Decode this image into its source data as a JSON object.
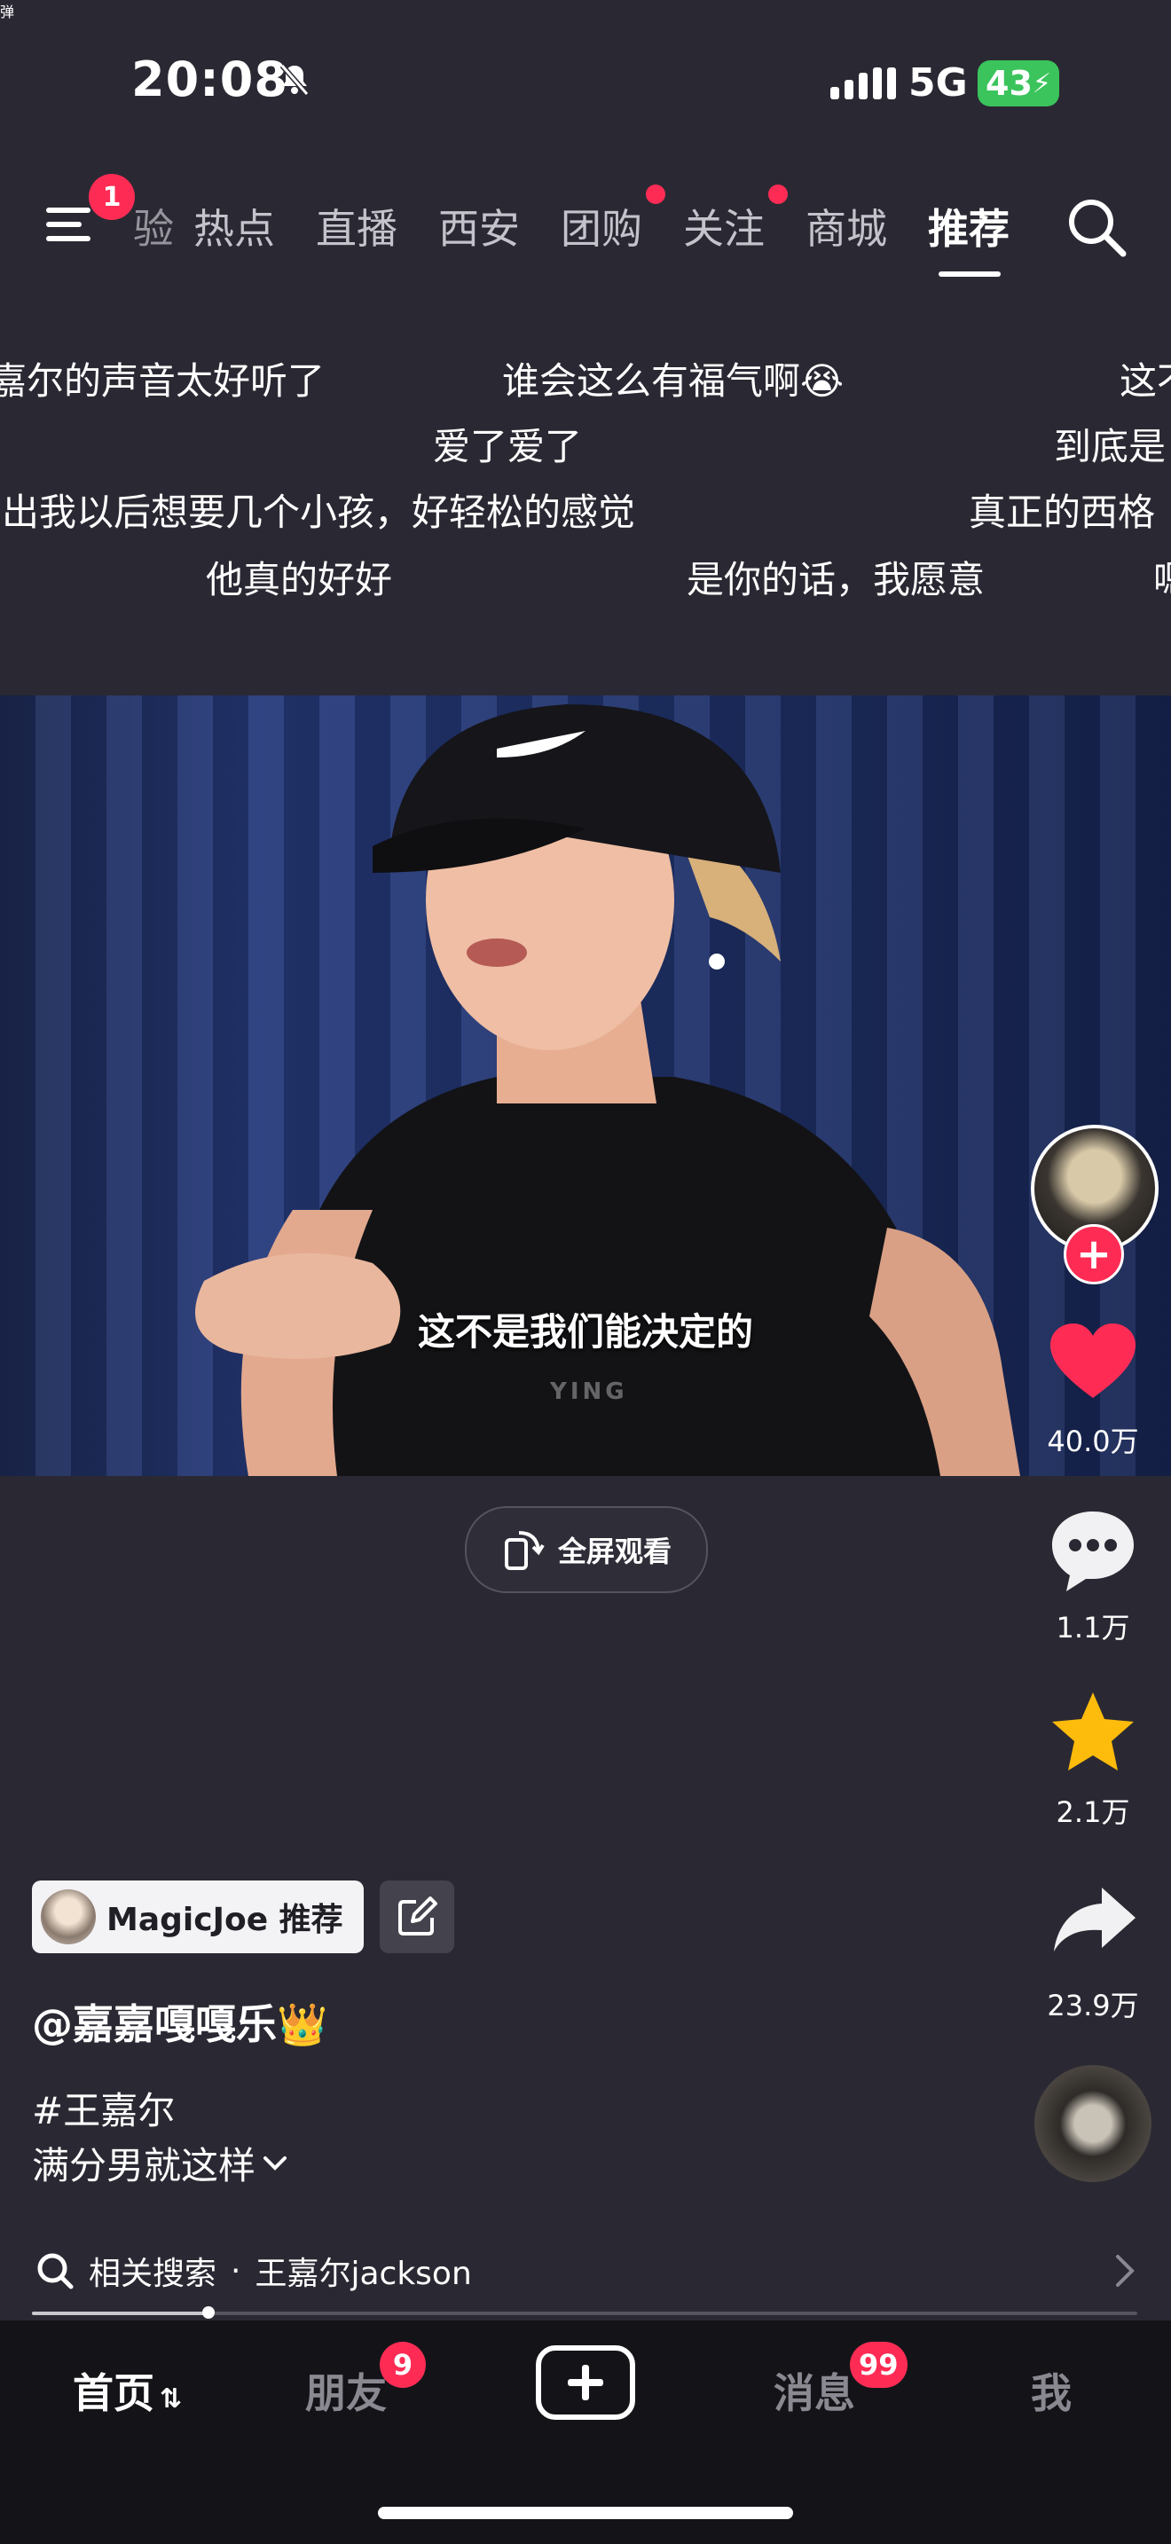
{
  "status_bar": {
    "time": "20:08",
    "network": "5G",
    "battery": "43"
  },
  "top_nav": {
    "menu_badge": "1",
    "tabs": [
      {
        "label": "验"
      },
      {
        "label": "热点"
      },
      {
        "label": "直播"
      },
      {
        "label": "西安"
      },
      {
        "label": "团购"
      },
      {
        "label": "关注"
      },
      {
        "label": "商城"
      },
      {
        "label": "推荐"
      }
    ],
    "active_tab": "推荐"
  },
  "danmaku": [
    "嘉尔的声音太好听了",
    "谁会这么有福气啊😭",
    "这不",
    "爱了爱了",
    "到底是",
    "出我以后想要几个小孩，好轻松的感觉",
    "真正的西格",
    "他真的好好",
    "是你的话，我愿意",
    "嗯"
  ],
  "video": {
    "subtitle": "这不是我们能决定的",
    "watermark": "YING"
  },
  "fullscreen_label": "全屏观看",
  "actions": {
    "likes": "40.0万",
    "comments": "1.1万",
    "favorites": "2.1万",
    "shares": "23.9万"
  },
  "info": {
    "danmaku_toggle": "弹",
    "recommender": "MagicJoe 推荐",
    "author": "@嘉嘉嘎嘎乐👑",
    "hashtag": "#王嘉尔",
    "description": "满分男就这样"
  },
  "related_search": {
    "label": "相关搜索",
    "separator": "·",
    "query": "王嘉尔jackson"
  },
  "playback_progress": 0.16,
  "bottom_nav": {
    "home": "首页",
    "friends": "朋友",
    "friends_badge": "9",
    "messages": "消息",
    "messages_badge": "99",
    "me": "我"
  },
  "colors": {
    "accent": "#fe2c55",
    "like": "#fe2c55",
    "star": "#fdbb0b",
    "background": "#2a2933"
  }
}
